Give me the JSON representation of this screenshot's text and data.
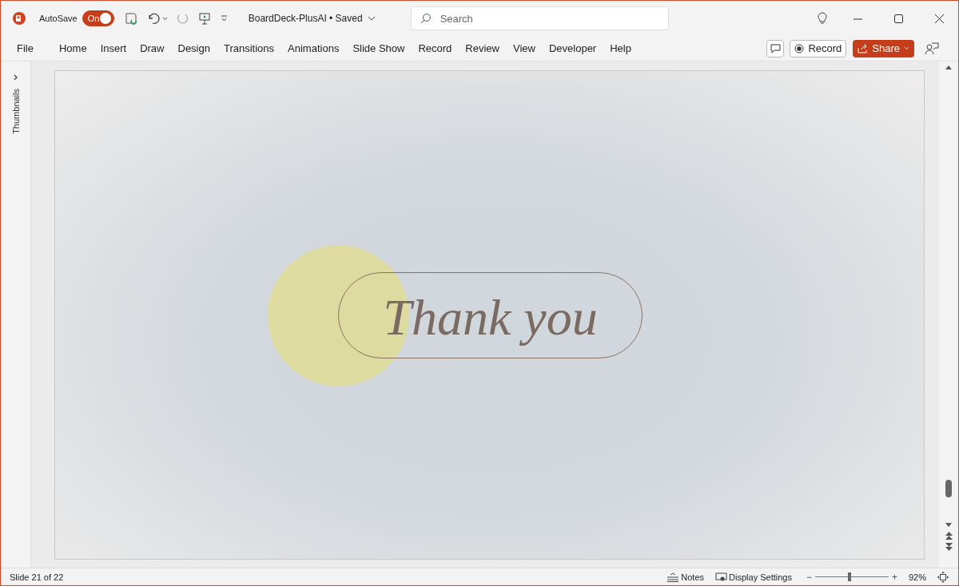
{
  "app": {
    "autosave_label": "AutoSave",
    "autosave": {
      "label": "On",
      "on": true
    },
    "document_title": "BoardDeck-PlusAI • Saved"
  },
  "search": {
    "placeholder": "Search"
  },
  "ribbon_tabs": [
    {
      "label": "File",
      "selected": false
    },
    {
      "label": "Home",
      "selected": false
    },
    {
      "label": "Insert",
      "selected": false
    },
    {
      "label": "Draw",
      "selected": false
    },
    {
      "label": "Design",
      "selected": false
    },
    {
      "label": "Transitions",
      "selected": false
    },
    {
      "label": "Animations",
      "selected": false
    },
    {
      "label": "Slide Show",
      "selected": false
    },
    {
      "label": "Record",
      "selected": false
    },
    {
      "label": "Review",
      "selected": false
    },
    {
      "label": "View",
      "selected": false
    },
    {
      "label": "Developer",
      "selected": false
    },
    {
      "label": "Help",
      "selected": false
    }
  ],
  "ribbon_buttons": {
    "record": "Record",
    "share": "Share"
  },
  "thumbnails_pane": {
    "label": "Thumbnails",
    "expanded": false
  },
  "slide": {
    "title": "Thank you"
  },
  "status_bar": {
    "slide_info": "Slide 21 of 22",
    "notes": "Notes",
    "display_settings": "Display Settings",
    "zoom": {
      "minus": "−",
      "plus": "+",
      "level": 0.47,
      "reading": "92%"
    }
  }
}
